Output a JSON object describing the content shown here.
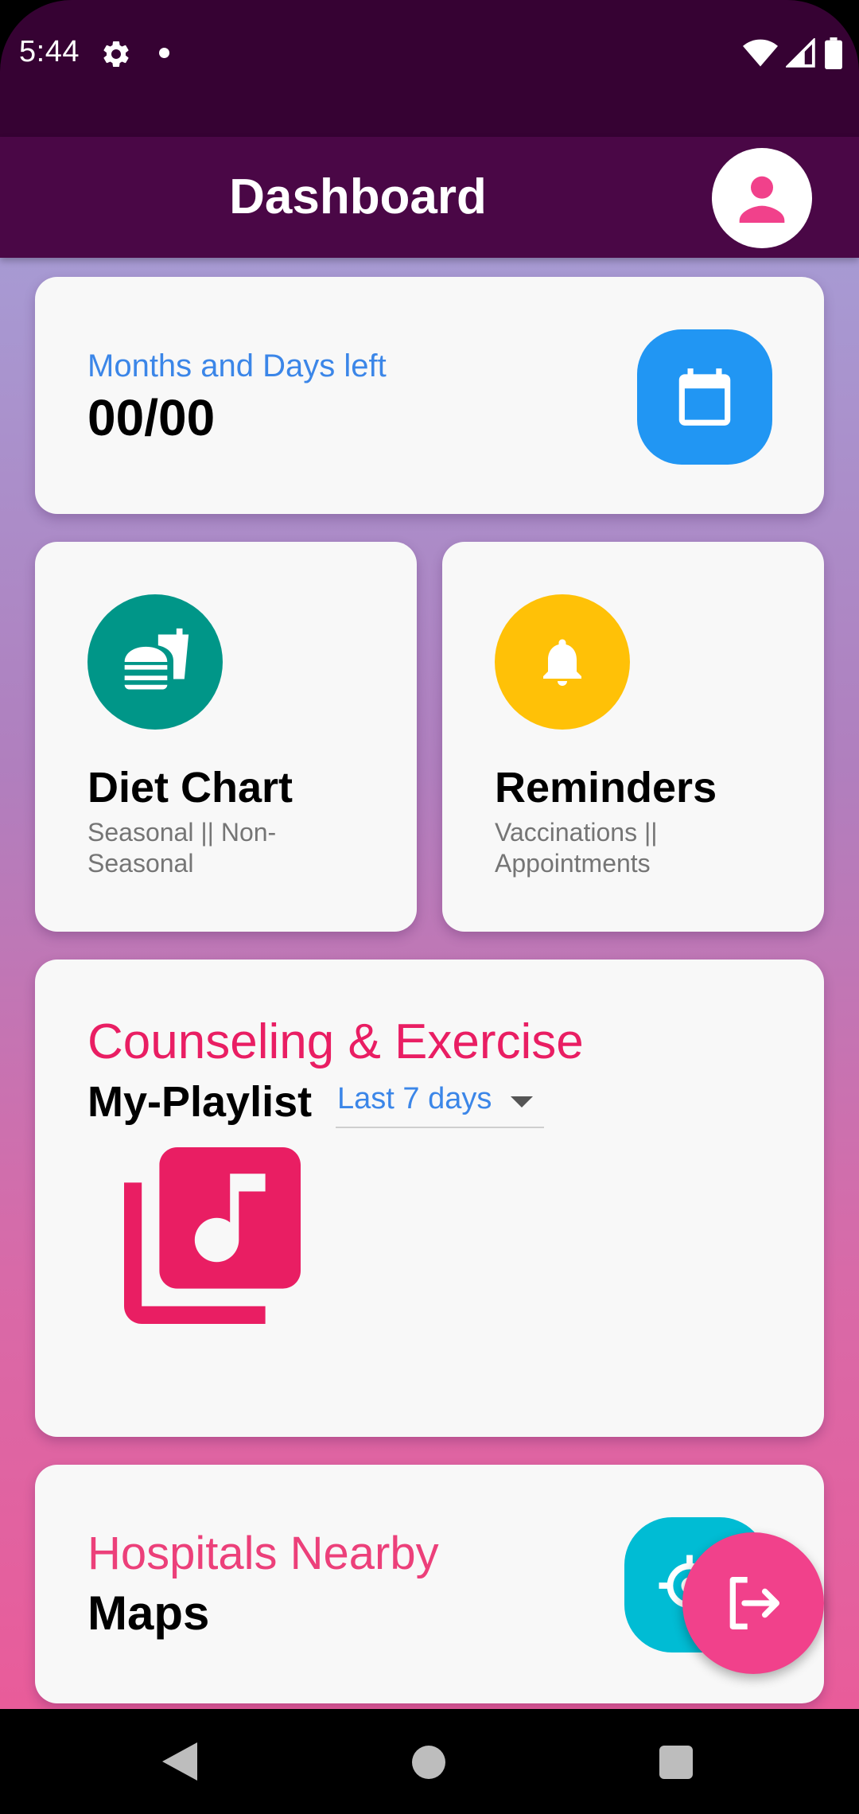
{
  "status_bar": {
    "time": "5:44",
    "icons": [
      "gear-icon",
      "notification-dot",
      "wifi-icon",
      "cellular-signal-icon",
      "battery-icon"
    ]
  },
  "app_bar": {
    "title": "Dashboard",
    "avatar_icon": "account-icon"
  },
  "countdown_card": {
    "label": "Months and Days left",
    "value": "00/00",
    "icon": "calendar-icon",
    "icon_color": "#2196f3"
  },
  "diet_card": {
    "title": "Diet Chart",
    "subtitle": "Seasonal || Non-Seasonal",
    "icon": "fastfood-icon",
    "icon_color": "#009688"
  },
  "reminders_card": {
    "title": "Reminders",
    "subtitle": "Vaccinations || Appointments",
    "icon": "bell-icon",
    "icon_color": "#ffc107"
  },
  "counseling_card": {
    "title": "Counseling & Exercise",
    "playlist_label": "My-Playlist",
    "period_select": "Last 7 days",
    "icon": "library-music-icon",
    "icon_color": "#e91e63"
  },
  "hospitals_card": {
    "title": "Hospitals Nearby",
    "subtitle": "Maps",
    "icon": "my-location-icon",
    "icon_color": "#00bcd4"
  },
  "fab": {
    "icon": "logout-icon",
    "color": "#f1418b"
  },
  "colors": {
    "status_bar": "#360233",
    "app_bar": "#4a0746",
    "accent_blue": "#3b86e8",
    "accent_pink": "#e91e63"
  }
}
